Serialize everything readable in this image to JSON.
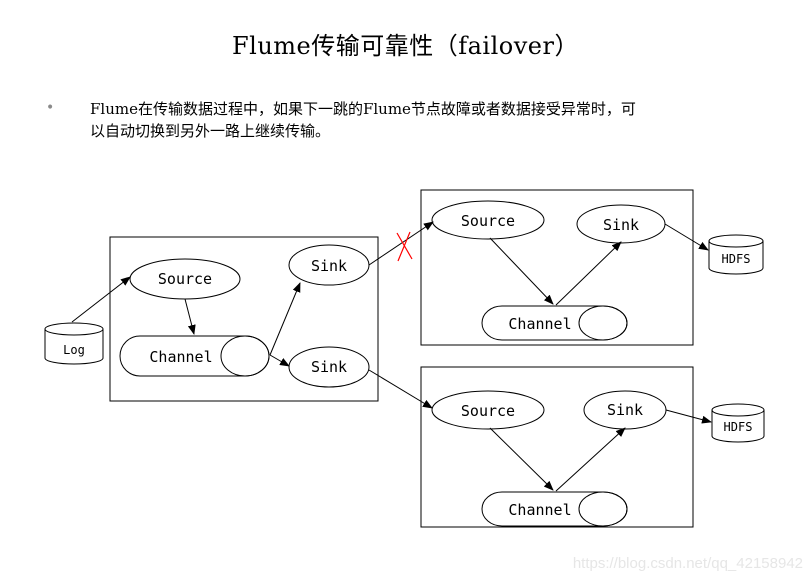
{
  "title": "Flume传输可靠性（failover）",
  "bullet": {
    "line1": "Flume在传输数据过程中，如果下一跳的Flume节点故障或者数据接受异常时，可",
    "line2": "以自动切换到另外一路上继续传输。"
  },
  "diagram": {
    "log_label": "Log",
    "agent1": {
      "source_label": "Source",
      "channel_label": "Channel",
      "sink1_label": "Sink",
      "sink2_label": "Sink"
    },
    "agent2": {
      "source_label": "Source",
      "channel_label": "Channel",
      "sink_label": "Sink",
      "hdfs_label": "HDFS",
      "status": "failed"
    },
    "agent3": {
      "source_label": "Source",
      "channel_label": "Channel",
      "sink_label": "Sink",
      "hdfs_label": "HDFS"
    },
    "failure_mark_color": "#ff0000"
  },
  "watermark": "https://blog.csdn.net/qq_42158942"
}
